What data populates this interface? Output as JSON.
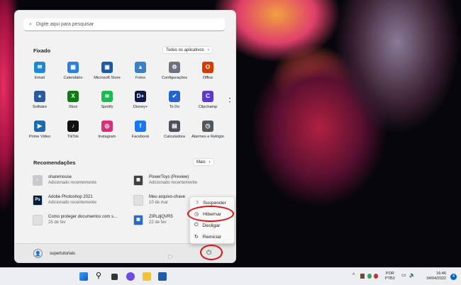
{
  "search": {
    "placeholder": "Digite aqui para pesquisar",
    "icon": "search-icon"
  },
  "pinned": {
    "title": "Fixado",
    "all_apps": "Todos os aplicativos",
    "apps": [
      {
        "label": "Email",
        "color": "#1a8ad8",
        "glyph": "✉"
      },
      {
        "label": "Calendário",
        "color": "#2b7fe0",
        "glyph": "▦"
      },
      {
        "label": "Microsoft Store",
        "color": "#1e5aa8",
        "glyph": "▣"
      },
      {
        "label": "Fotos",
        "color": "#3a80c8",
        "glyph": "▲"
      },
      {
        "label": "Configurações",
        "color": "#6b7380",
        "glyph": "⚙"
      },
      {
        "label": "Office",
        "color": "#d83b01",
        "glyph": "O"
      },
      {
        "label": "Solitaire",
        "color": "#2a5aa0",
        "glyph": "♠"
      },
      {
        "label": "Xbox",
        "color": "#107c10",
        "glyph": "X"
      },
      {
        "label": "Spotify",
        "color": "#1db954",
        "glyph": "≋"
      },
      {
        "label": "Disney+",
        "color": "#0e1a4a",
        "glyph": "D+"
      },
      {
        "label": "To Do",
        "color": "#2564cf",
        "glyph": "✔"
      },
      {
        "label": "Clipchamp",
        "color": "#5a3ad0",
        "glyph": "C"
      },
      {
        "label": "Prime Video",
        "color": "#1a6bb0",
        "glyph": "▶"
      },
      {
        "label": "TikTok",
        "color": "#111111",
        "glyph": "♪"
      },
      {
        "label": "Instagram",
        "color": "#d6307a",
        "glyph": "◎"
      },
      {
        "label": "Facebook",
        "color": "#1877f2",
        "glyph": "f"
      },
      {
        "label": "Calculadora",
        "color": "#4a5060",
        "glyph": "▤"
      },
      {
        "label": "Alarmes e Relógio",
        "color": "#505860",
        "glyph": "◷"
      }
    ]
  },
  "recommended": {
    "title": "Recomendações",
    "more": "Mais",
    "items": [
      {
        "name": "sharemouse",
        "sub": "Adicionado recentemente",
        "color": "#c8c8d0",
        "glyph": "◐"
      },
      {
        "name": "PowerToys (Preview)",
        "sub": "Adicionado recentemente",
        "color": "#404040",
        "glyph": "▦"
      },
      {
        "name": "Adobe Photoshop 2021",
        "sub": "Adicionado recentemente",
        "color": "#001e36",
        "glyph": "Ps"
      },
      {
        "name": "Meu arquivo-chave",
        "sub": "10 de mar",
        "color": "#e0e0e0",
        "glyph": ""
      },
      {
        "name": "Como proteger documentos com s...",
        "sub": "25 de fev",
        "color": "#e0e0e0",
        "glyph": ""
      },
      {
        "name": "ZIPLdjQVR5",
        "sub": "22 de fev",
        "color": "#2a6ac0",
        "glyph": "▣"
      }
    ]
  },
  "user": {
    "name": "supertutoriais"
  },
  "power_menu": [
    {
      "label": "Suspender",
      "icon": "moon-icon",
      "glyph": "☽"
    },
    {
      "label": "Hibernar",
      "icon": "clock-icon",
      "glyph": "◷"
    },
    {
      "label": "Desligar",
      "icon": "power-icon",
      "glyph": "⏻"
    },
    {
      "label": "Reiniciar",
      "icon": "restart-icon",
      "glyph": "↻"
    }
  ],
  "taskbar": {
    "apps": [
      "start",
      "search",
      "task-view",
      "chat",
      "file-explorer",
      "store"
    ],
    "lang1": "POR",
    "lang2": "PTB2",
    "time": "16:46",
    "date": "04/04/2022",
    "notifications": "4"
  },
  "colors": {
    "annotation": "#e01010",
    "accent": "#0067c0"
  }
}
